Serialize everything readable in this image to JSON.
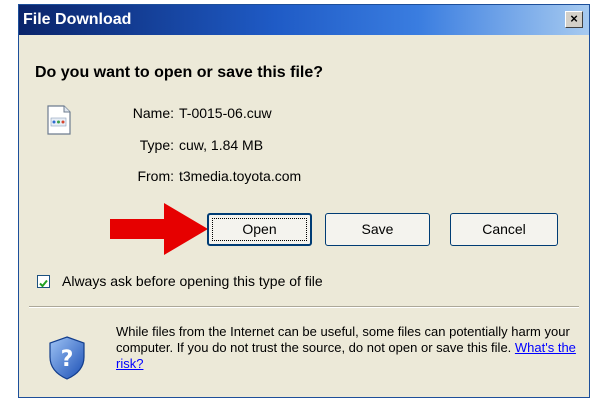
{
  "dialog": {
    "title": "File Download",
    "close_glyph": "×",
    "question": "Do you want to open or save this file?"
  },
  "file": {
    "icon": "file-icon",
    "name_label": "Name:",
    "name_value": "T-0015-06.cuw",
    "type_label": "Type:",
    "type_value": "cuw, 1.84 MB",
    "from_label": "From:",
    "from_value": "t3media.toyota.com"
  },
  "buttons": {
    "open": "Open",
    "save": "Save",
    "cancel": "Cancel"
  },
  "annotation": {
    "arrow_color": "#e60000",
    "icon": "arrow-right-icon"
  },
  "checkbox": {
    "checked": true,
    "label": "Always ask before opening this type of file"
  },
  "warning": {
    "icon": "shield-question-icon",
    "text": "While files from the Internet can be useful, some files can potentially harm your computer. If you do not trust the source, do not open or save this file.",
    "link": "What's the risk?"
  },
  "colors": {
    "titlebar": "#0a246a",
    "dialog_bg": "#ece9d8",
    "button_border": "#003c74",
    "link": "#0000ff"
  }
}
